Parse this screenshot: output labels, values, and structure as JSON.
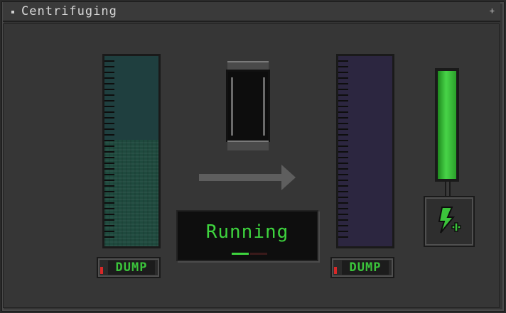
{
  "window": {
    "title": "Centrifuging",
    "close_glyph": "+"
  },
  "left_tank": {
    "fill_fraction": 0.56,
    "liquid_color": "#1f4a3e",
    "empty_color": "#1f3f3f"
  },
  "right_tank": {
    "fill_fraction": 0.0,
    "empty_color": "#2c2640"
  },
  "dump_left": {
    "label": "DUMP"
  },
  "dump_right": {
    "label": "DUMP"
  },
  "status": {
    "text": "Running"
  },
  "power": {
    "fill_fraction": 1.0,
    "color": "#48d448",
    "icon": "lightning-plus-icon"
  },
  "colors": {
    "accent_green": "#3ed43e",
    "led_red": "#d82828"
  }
}
